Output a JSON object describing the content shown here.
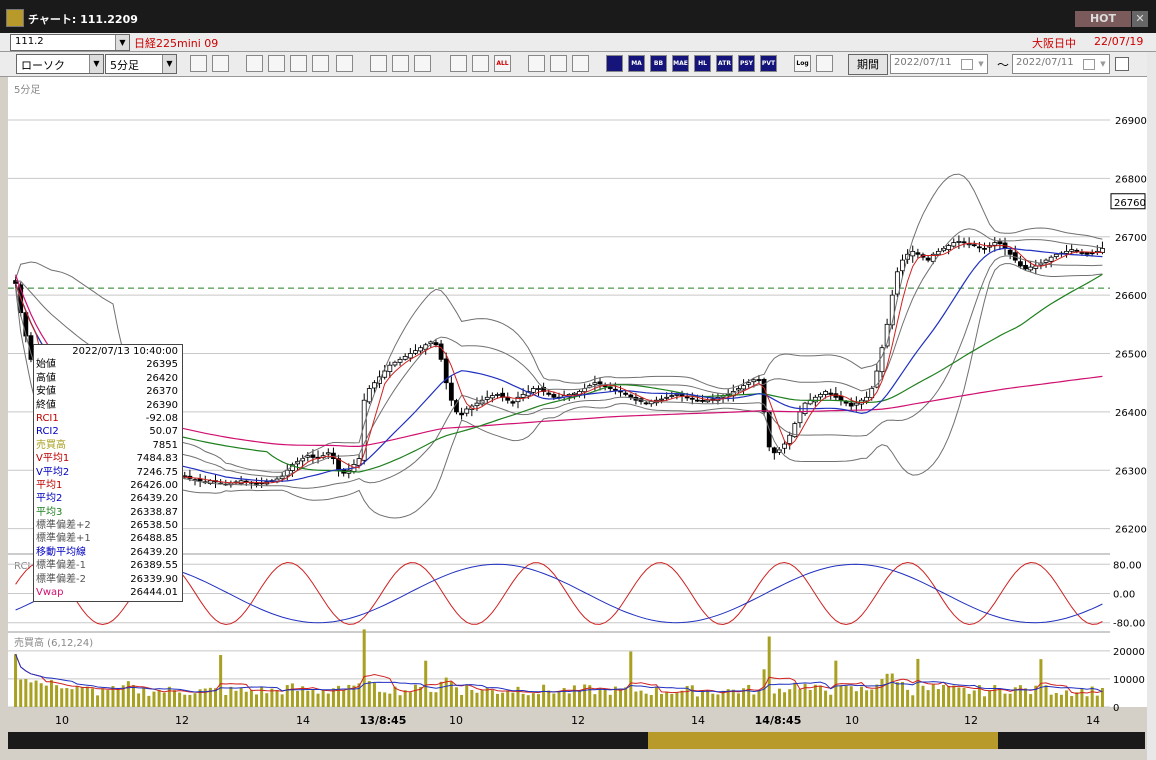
{
  "window": {
    "title": "チャート: 111.2209",
    "hot_label": "HOT",
    "close_label": "✕"
  },
  "symbol_bar": {
    "code": "111.2",
    "name": "日経225mini 09",
    "session": "大阪日中",
    "date": "22/07/19"
  },
  "toolbar": {
    "chart_type": "ローソク",
    "interval": "5分足",
    "buttons": [
      "zoom",
      "crosshair",
      "down",
      "search",
      "bars",
      "candles",
      "rule",
      "draw",
      "pointer",
      "arrow",
      "candle",
      "compare",
      "ALL",
      "settings",
      "tools",
      "colors",
      "ichimoku",
      "MA",
      "BB",
      "MAE",
      "HL",
      "ATR",
      "PSY",
      "PVT",
      "Log",
      "export"
    ],
    "period_label": "期間",
    "date_from": "2022/07/11",
    "date_to": "2022/07/11",
    "range_sep": "〜"
  },
  "colors": {
    "candle_up": "#ffffff",
    "candle_down": "#000000",
    "ma1": "#d02020",
    "ma2": "#2030c0",
    "ma3": "#208020",
    "vwap": "#d01070",
    "bollinger": "#707070",
    "volume": "#a8a020",
    "dashed_level": "#208020"
  },
  "chart_data": {
    "type": "candlestick",
    "price_panel": {
      "label": "5分足",
      "y_ticks": [
        26900,
        26800,
        26700,
        26600,
        26500,
        26400,
        26300,
        26200
      ],
      "ylim": [
        26160,
        26960
      ],
      "last_price": 26760,
      "dashed_level": 26612,
      "closes": [
        26620,
        26570,
        26530,
        26490,
        26460,
        26440,
        26420,
        26400,
        26370,
        26350,
        26340,
        26330,
        26335,
        26330,
        26325,
        26328,
        26330,
        26332,
        26320,
        26318,
        26322,
        26325,
        26300,
        26305,
        26300,
        26298,
        26295,
        26290,
        26292,
        26290,
        26288,
        26286,
        26290,
        26288,
        26286,
        26284,
        26282,
        26280,
        26282,
        26280,
        26278,
        26276,
        26278,
        26280,
        26282,
        26280,
        26278,
        26276,
        26278,
        26280,
        26282,
        26285,
        26290,
        26300,
        26310,
        26315,
        26320,
        26325,
        26322,
        26320,
        26325,
        26330,
        26320,
        26300,
        26295,
        26300,
        26310,
        26320,
        26420,
        26440,
        26450,
        26460,
        26470,
        26480,
        26485,
        26490,
        26495,
        26500,
        26505,
        26510,
        26515,
        26520,
        26515,
        26490,
        26450,
        26420,
        26400,
        26395,
        26405,
        26410,
        26415,
        26420,
        26425,
        26428,
        26430,
        26425,
        26420,
        26415,
        26425,
        26430,
        26435,
        26440,
        26440,
        26435,
        26430,
        26425,
        26425,
        26428,
        26430,
        26432,
        26435,
        26440,
        26445,
        26450,
        26448,
        26445,
        26440,
        26438,
        26435,
        26430,
        26425,
        26420,
        26418,
        26415,
        26418,
        26420,
        26422,
        26425,
        26428,
        26430,
        26428,
        26425,
        26422,
        26420,
        26418,
        26420,
        26422,
        26425,
        26428,
        26430,
        26435,
        26440,
        26445,
        26450,
        26455,
        26455,
        26400,
        26340,
        26330,
        26335,
        26345,
        26360,
        26380,
        26400,
        26415,
        26420,
        26425,
        26430,
        26435,
        26430,
        26425,
        26420,
        26415,
        26410,
        26415,
        26420,
        26425,
        26440,
        26470,
        26510,
        26550,
        26600,
        26640,
        26660,
        26670,
        26675,
        26670,
        26665,
        26660,
        26670,
        26675,
        26680,
        26685,
        26690,
        26692,
        26690,
        26688,
        26685,
        26682,
        26680,
        26685,
        26690,
        26688,
        26680,
        26670,
        26660,
        26650,
        26645,
        26648,
        26650,
        26655,
        26660,
        26665,
        26670,
        26672,
        26675,
        26678,
        26675,
        26672,
        26670,
        26672,
        26675,
        26680
      ],
      "series": [
        {
          "name": "平均1",
          "value": 26426.0
        },
        {
          "name": "平均2",
          "value": 26439.2
        },
        {
          "name": "平均3",
          "value": 26338.87
        },
        {
          "name": "Vwap",
          "value": 26444.01
        }
      ]
    },
    "rci_panel": {
      "label": "RCI",
      "y_ticks": [
        80,
        0,
        -80
      ],
      "y_tick_labels": [
        "80.00",
        "0.00",
        "-80.00"
      ],
      "ylim": [
        -100,
        100
      ]
    },
    "volume_panel": {
      "label": "売買高 (6,12,24)",
      "y_ticks": [
        20000,
        10000,
        0
      ],
      "ylim": [
        0,
        26000
      ]
    },
    "x_axis": {
      "tick_labels": [
        "10",
        "12",
        "14",
        "13/8:45",
        "10",
        "12",
        "14",
        "14/8:45",
        "10",
        "12",
        "14"
      ],
      "bold": [
        false,
        false,
        false,
        true,
        false,
        false,
        false,
        true,
        false,
        false,
        false
      ]
    },
    "info_panel": {
      "datetime": "2022/07/13 10:40:00",
      "rows": [
        {
          "label": "始値",
          "value": "26395",
          "color": "#000000"
        },
        {
          "label": "高値",
          "value": "26420",
          "color": "#000000"
        },
        {
          "label": "安値",
          "value": "26370",
          "color": "#000000"
        },
        {
          "label": "終値",
          "value": "26390",
          "color": "#000000"
        },
        {
          "label": "RCI1",
          "value": "-92.08",
          "color": "#c00000"
        },
        {
          "label": "RCI2",
          "value": "50.07",
          "color": "#0000c0"
        },
        {
          "label": "売買高",
          "value": "7851",
          "color": "#a8a020"
        },
        {
          "label": "V平均1",
          "value": "7484.83",
          "color": "#c00000"
        },
        {
          "label": "V平均2",
          "value": "7246.75",
          "color": "#0000c0"
        },
        {
          "label": "平均1",
          "value": "26426.00",
          "color": "#c00000"
        },
        {
          "label": "平均2",
          "value": "26439.20",
          "color": "#0000c0"
        },
        {
          "label": "平均3",
          "value": "26338.87",
          "color": "#208020"
        },
        {
          "label": "標準偏差+2",
          "value": "26538.50",
          "color": "#555555"
        },
        {
          "label": "標準偏差+1",
          "value": "26488.85",
          "color": "#555555"
        },
        {
          "label": "移動平均線",
          "value": "26439.20",
          "color": "#0000c0"
        },
        {
          "label": "標準偏差-1",
          "value": "26389.55",
          "color": "#555555"
        },
        {
          "label": "標準偏差-2",
          "value": "26339.90",
          "color": "#555555"
        },
        {
          "label": "Vwap",
          "value": "26444.01",
          "color": "#d01070"
        }
      ]
    }
  }
}
